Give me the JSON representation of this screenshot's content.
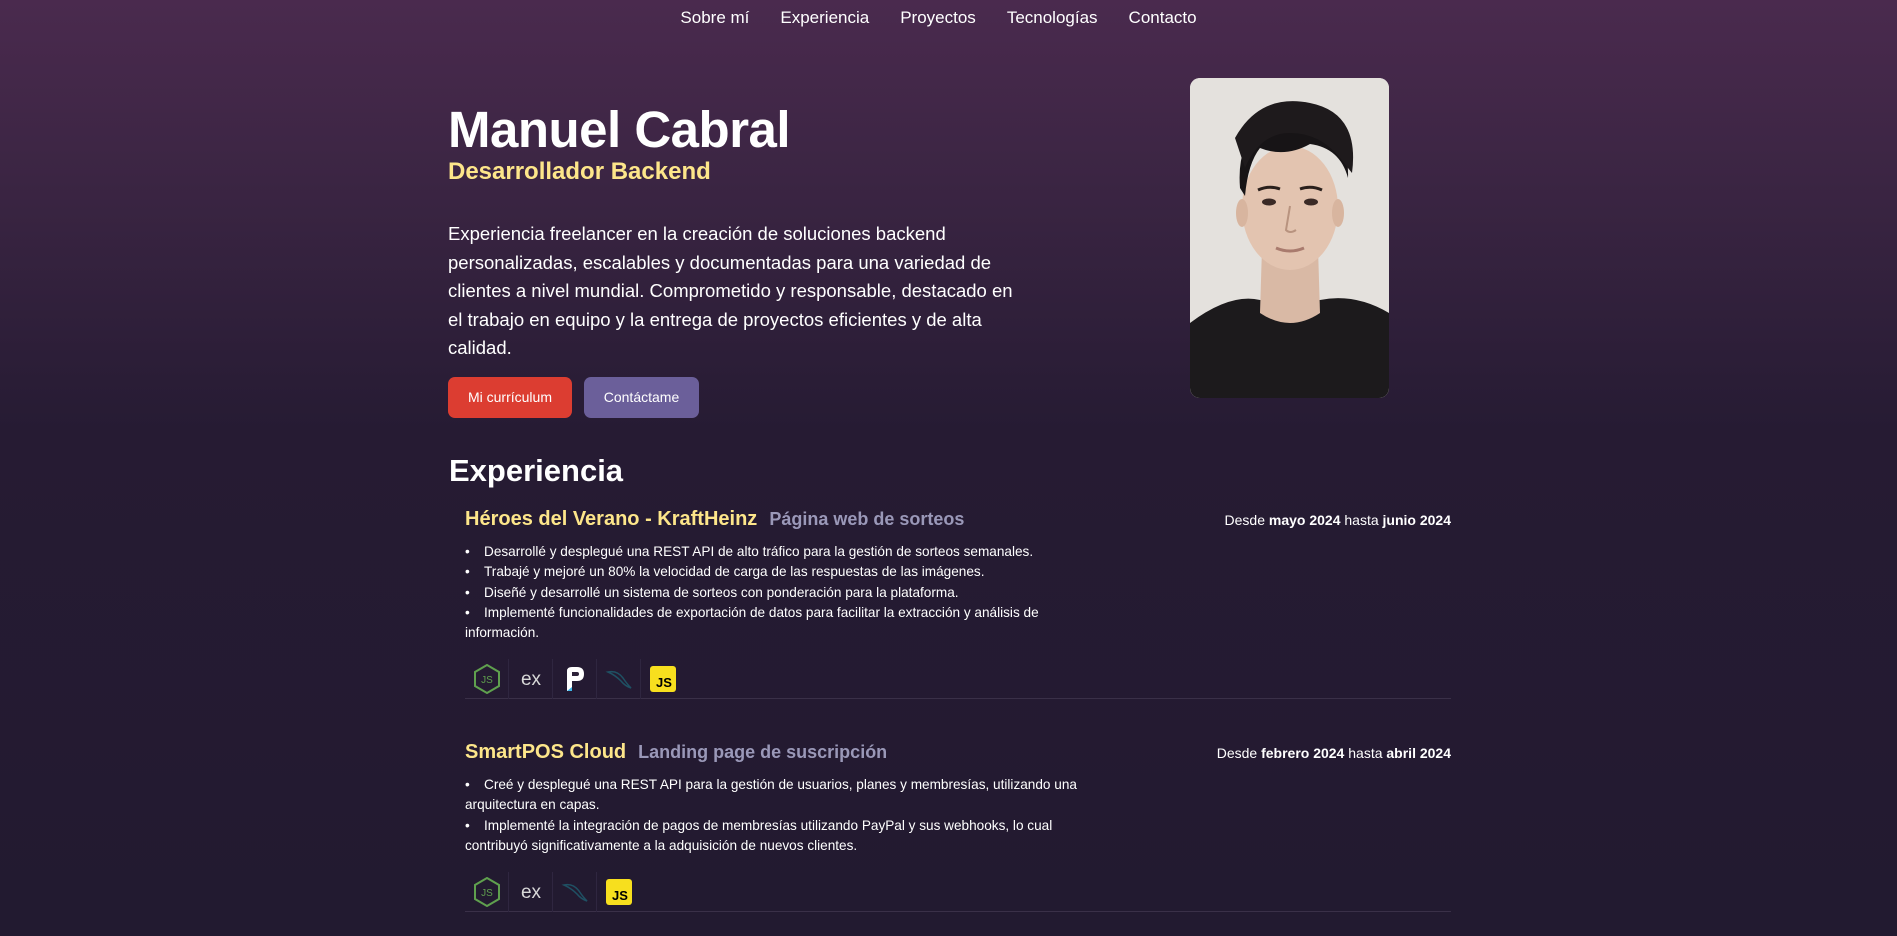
{
  "nav": {
    "items": [
      "Sobre mí",
      "Experiencia",
      "Proyectos",
      "Tecnologías",
      "Contacto"
    ]
  },
  "hero": {
    "name": "Manuel Cabral",
    "role": "Desarrollador Backend",
    "description": "Experiencia freelancer en la creación de soluciones backend personalizadas, escalables y documentadas para una variedad de clientes a nivel mundial. Comprometido y responsable, destacado en el trabajo en equipo y la entrega de proyectos eficientes y de alta calidad.",
    "cv_button": "Mi currículum",
    "contact_button": "Contáctame"
  },
  "experience": {
    "title": "Experiencia",
    "items": [
      {
        "company": "Héroes del Verano - KraftHeinz",
        "project": "Página web de sorteos",
        "date_prefix": "Desde",
        "start": "mayo 2024",
        "date_middle": "hasta",
        "end": "junio 2024",
        "bullets": [
          "Desarrollé y desplegué una REST API de alto tráfico para la gestión de sorteos semanales.",
          "Trabajé y mejoré un 80% la velocidad de carga de las respuestas de las imágenes.",
          "Diseñé y desarrollé un sistema de sorteos con ponderación para la plataforma.",
          "Implementé funcionalidades de exportación de datos para facilitar la extracción y análisis de información."
        ],
        "tech_icons": [
          "nodejs-icon",
          "express-icon",
          "prisma-icon",
          "mysql-icon",
          "javascript-icon"
        ]
      },
      {
        "company": "SmartPOS Cloud",
        "project": "Landing page de suscripción",
        "date_prefix": "Desde",
        "start": "febrero 2024",
        "date_middle": "hasta",
        "end": "abril 2024",
        "bullets": [
          "Creé y desplegué una REST API para la gestión de usuarios, planes y membresías, utilizando una arquitectura en capas.",
          "Implementé la integración de pagos de membresías utilizando PayPal y sus webhooks, lo cual contribuyó significativamente a la adquisición de nuevos clientes."
        ],
        "tech_icons": [
          "nodejs-icon",
          "express-icon",
          "mysql-icon",
          "javascript-icon"
        ]
      }
    ]
  },
  "colors": {
    "accent_yellow": "#fde68a",
    "button_red": "#dc3d31",
    "button_purple": "#6b5f9a",
    "muted_project": "#9a98b8"
  }
}
